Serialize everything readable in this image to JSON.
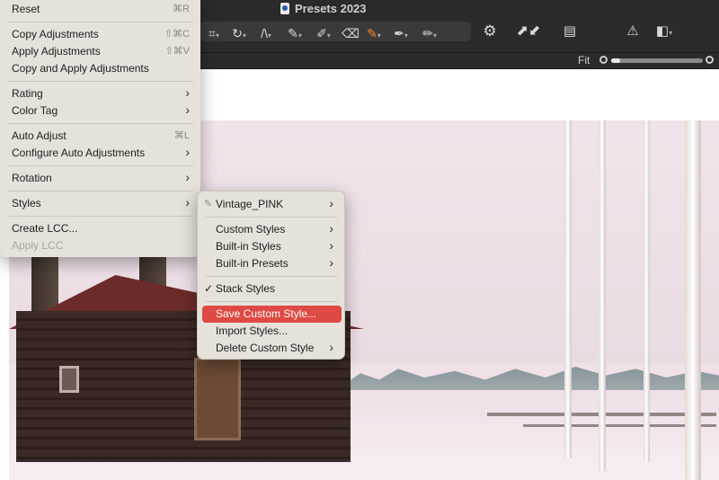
{
  "window": {
    "title": "Presets 2023"
  },
  "viewer": {
    "fit_label": "Fit"
  },
  "zoom": {
    "level_fraction": 0.1
  },
  "toolbar": {
    "icons": [
      "crop-icon",
      "rotate-icon",
      "straighten-icon",
      "brush-icon",
      "eraser-brush-icon",
      "eraser-icon",
      "color-picker-icon",
      "gradient-icon",
      "heal-icon",
      "gear-icon",
      "apply-copy-arrows-icon",
      "stack-icon",
      "warning-icon",
      "compare-icon"
    ],
    "accent_color": "#f28a2b"
  },
  "main_menu": {
    "reset": {
      "label": "Reset",
      "shortcut": "⌘R"
    },
    "copy_adjustments": {
      "label": "Copy Adjustments",
      "shortcut": "⇧⌘C"
    },
    "apply_adjustments": {
      "label": "Apply Adjustments",
      "shortcut": "⇧⌘V"
    },
    "copy_and_apply": {
      "label": "Copy and Apply Adjustments"
    },
    "rating": {
      "label": "Rating"
    },
    "color_tag": {
      "label": "Color Tag"
    },
    "auto_adjust": {
      "label": "Auto Adjust",
      "shortcut": "⌘L"
    },
    "configure_auto": {
      "label": "Configure Auto Adjustments"
    },
    "rotation": {
      "label": "Rotation"
    },
    "styles": {
      "label": "Styles"
    },
    "create_lcc": {
      "label": "Create LCC..."
    },
    "apply_lcc": {
      "label": "Apply LCC"
    }
  },
  "styles_submenu": {
    "vintage_pink": {
      "label": "Vintage_PINK"
    },
    "custom_styles": {
      "label": "Custom Styles"
    },
    "builtin_styles": {
      "label": "Built-in Styles"
    },
    "builtin_presets": {
      "label": "Built-in Presets"
    },
    "stack_styles": {
      "label": "Stack Styles",
      "checked_mark": "✓"
    },
    "save_custom_style": {
      "label": "Save Custom Style..."
    },
    "import_styles": {
      "label": "Import Styles..."
    },
    "delete_custom_style": {
      "label": "Delete Custom Style"
    },
    "highlight_color": "#de4a43"
  }
}
